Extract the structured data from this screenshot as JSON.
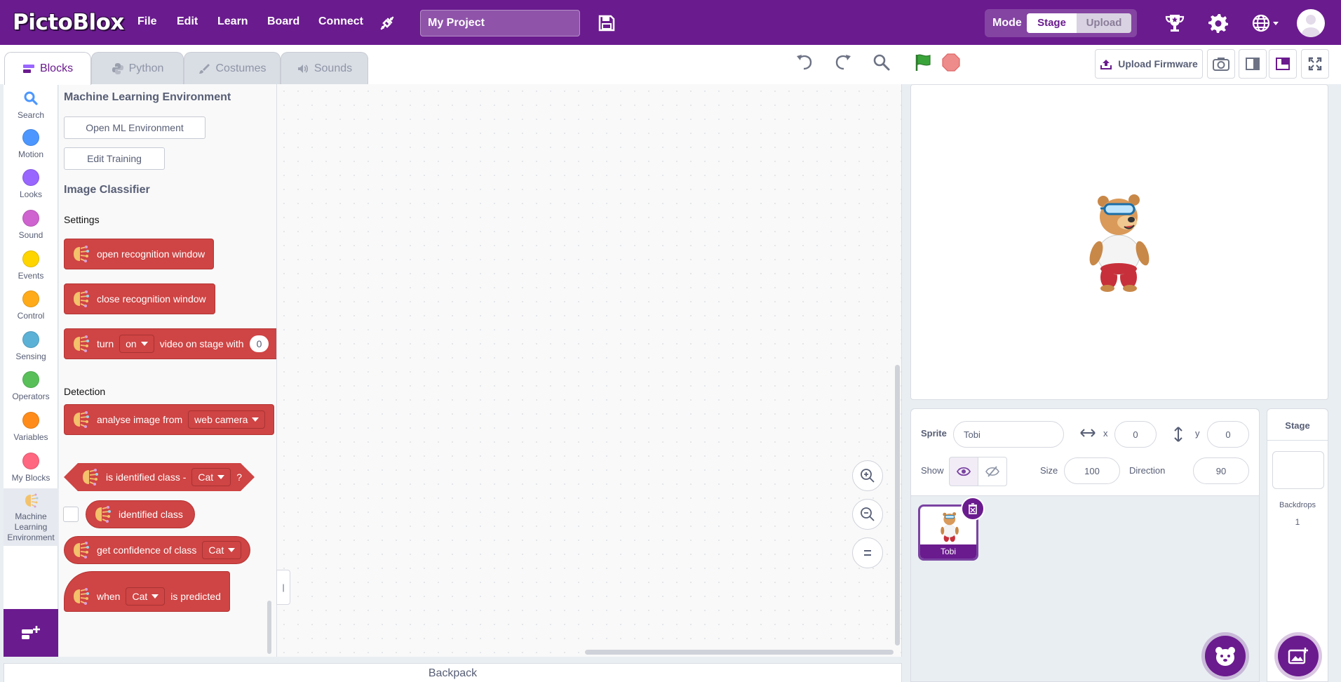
{
  "app": {
    "logo": "PictoBlox",
    "menu": [
      "File",
      "Edit",
      "Learn",
      "Board",
      "Connect"
    ],
    "project_name": "My Project",
    "mode": {
      "label": "Mode",
      "stage": "Stage",
      "upload": "Upload"
    },
    "accent_color": "#6a1b8e"
  },
  "tabs": [
    {
      "label": "Blocks",
      "icon": "blocks-icon"
    },
    {
      "label": "Python",
      "icon": "python-icon"
    },
    {
      "label": "Costumes",
      "icon": "brush-icon"
    },
    {
      "label": "Sounds",
      "icon": "speaker-icon"
    }
  ],
  "toolbar": {
    "upload_firmware": "Upload Firmware"
  },
  "categories": [
    {
      "label": "Search",
      "color": "#4c97ff",
      "icon": "search-icon"
    },
    {
      "label": "Motion",
      "color": "#4c97ff"
    },
    {
      "label": "Looks",
      "color": "#9966ff"
    },
    {
      "label": "Sound",
      "color": "#cf63cf"
    },
    {
      "label": "Events",
      "color": "#ffd500"
    },
    {
      "label": "Control",
      "color": "#ffab19"
    },
    {
      "label": "Sensing",
      "color": "#5cb1d6"
    },
    {
      "label": "Operators",
      "color": "#59c059"
    },
    {
      "label": "Variables",
      "color": "#ff8c1a"
    },
    {
      "label": "My Blocks",
      "color": "#ff6680"
    },
    {
      "label": "Machine Learning Environment",
      "icon": "brain-icon"
    }
  ],
  "flyout": {
    "heading1": "Machine Learning Environment",
    "btn_open_ml": "Open ML Environment",
    "btn_edit_training": "Edit Training",
    "heading2": "Image Classifier",
    "settings": "Settings",
    "detection": "Detection",
    "blocks": {
      "open_window": "open recognition window",
      "close_window": "close recognition window",
      "turn": "turn",
      "turn_dd": "on",
      "video_on_stage": "video on stage with",
      "transparency": "0",
      "analyse": "analyse image from",
      "analyse_dd": "web camera",
      "is_identified": "is identified class -",
      "is_identified_dd": "Cat",
      "qmark": "?",
      "identified_class": "identified class",
      "get_confidence": "get confidence of class",
      "get_confidence_dd": "Cat",
      "when": "when",
      "when_dd": "Cat",
      "is_predicted": "is predicted"
    },
    "block_color": "#cf4444"
  },
  "collapse_label": "|",
  "backpack": "Backpack",
  "sprite": {
    "label": "Sprite",
    "name": "Tobi",
    "x_label": "x",
    "x": "0",
    "y_label": "y",
    "y": "0",
    "show_label": "Show",
    "size_label": "Size",
    "size": "100",
    "direction_label": "Direction",
    "direction": "90",
    "thumb_name": "Tobi"
  },
  "stage_pane": {
    "title": "Stage",
    "backdrops_label": "Backdrops",
    "backdrops_count": "1"
  }
}
